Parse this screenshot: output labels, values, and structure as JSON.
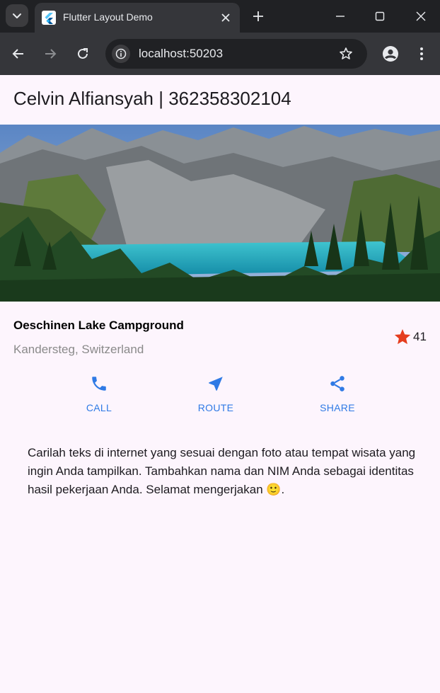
{
  "browser": {
    "tab_title": "Flutter Layout Demo",
    "url": "localhost:50203",
    "icons": {
      "tab_search": "chevron-down-icon",
      "favicon": "flutter-logo-icon",
      "tab_close": "close-icon",
      "new_tab": "plus-icon",
      "minimize": "minimize-icon",
      "maximize": "maximize-icon",
      "close": "close-icon",
      "back": "arrow-left-icon",
      "forward": "arrow-right-icon",
      "reload": "reload-icon",
      "site_info": "info-icon",
      "bookmark": "star-outline-icon",
      "profile": "account-icon",
      "menu": "more-vert-icon"
    }
  },
  "app": {
    "title": "Celvin Alfiansyah | 362358302104",
    "place": {
      "name": "Oeschinen Lake Campground",
      "location": "Kandersteg, Switzerland",
      "rating_count": "41",
      "rating_icon": "star-icon",
      "rating_color": "#e53d1e"
    },
    "actions": [
      {
        "label": "CALL",
        "icon": "phone-icon"
      },
      {
        "label": "ROUTE",
        "icon": "near-me-icon"
      },
      {
        "label": "SHARE",
        "icon": "share-icon"
      }
    ],
    "action_color": "#2f7ae5",
    "description": "Carilah teks di internet yang sesuai dengan foto atau tempat wisata yang ingin Anda tampilkan. Tambahkan nama dan NIM Anda sebagai identitas hasil pekerjaan Anda. Selamat mengerjakan 🙂."
  }
}
